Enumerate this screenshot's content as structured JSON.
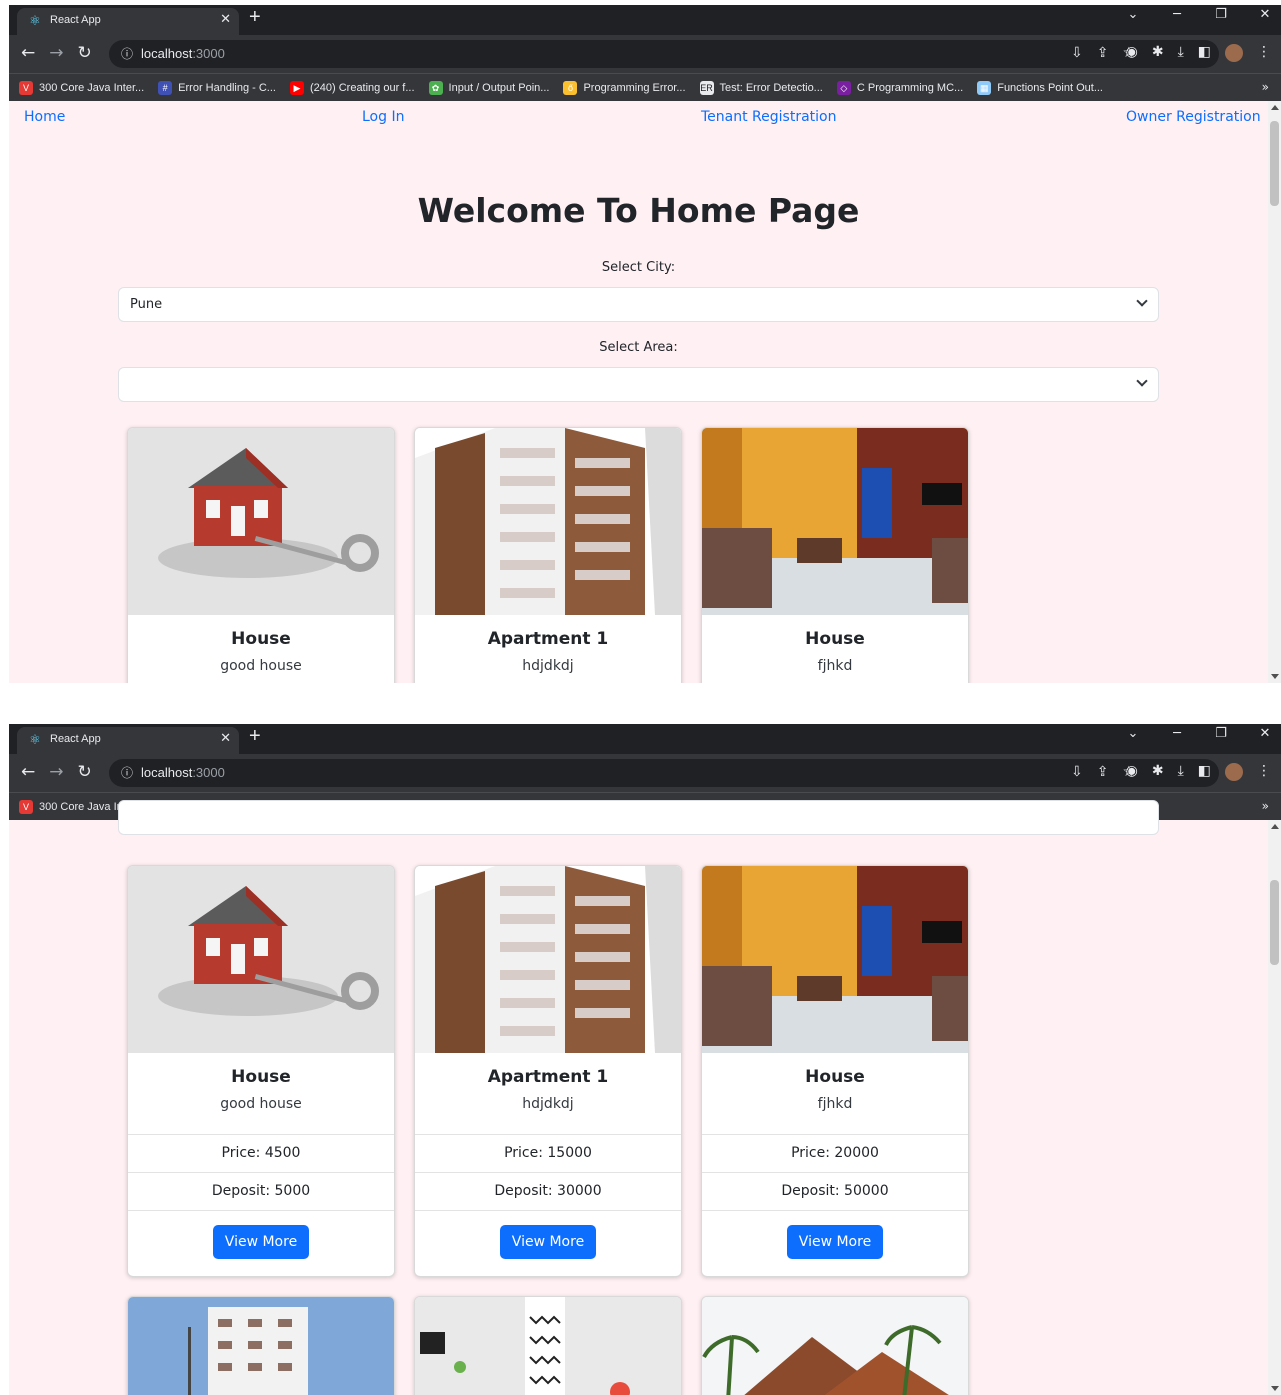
{
  "browser": {
    "tab_title": "React App",
    "url_host": "localhost",
    "url_port": ":3000",
    "bookmarks": [
      {
        "label": "300 Core Java Inter...",
        "color": "#e53935",
        "icon": "V"
      },
      {
        "label": "Error Handling - C...",
        "color": "#3f51b5",
        "icon": "#"
      },
      {
        "label": "(240) Creating our f...",
        "color": "#ff0000",
        "icon": "▶"
      },
      {
        "label": "Input / Output Poin...",
        "color": "#4caf50",
        "icon": "✿"
      },
      {
        "label": "Programming Error...",
        "color": "#fbc02d",
        "icon": "ő"
      },
      {
        "label": "Test: Error Detectio...",
        "color": "#e8eaed",
        "icon": "ER"
      },
      {
        "label": "C Programming MC...",
        "color": "#7b1fa2",
        "icon": "◇"
      },
      {
        "label": "Functions Point Out...",
        "color": "#90caf9",
        "icon": "▦"
      }
    ]
  },
  "nav": {
    "home": "Home",
    "login": "Log In",
    "tenant": "Tenant Registration",
    "owner": "Owner Registration"
  },
  "page": {
    "heading": "Welcome To Home Page",
    "city_label": "Select City:",
    "city_value": "Pune",
    "area_label": "Select Area:",
    "area_value": ""
  },
  "cards": [
    {
      "title": "House",
      "desc": "good house",
      "price": "Price: 4500",
      "deposit": "Deposit: 5000",
      "button": "View More"
    },
    {
      "title": "Apartment 1",
      "desc": "hdjdkdj",
      "price": "Price: 15000",
      "deposit": "Deposit: 30000",
      "button": "View More"
    },
    {
      "title": "House",
      "desc": "fjhkd",
      "price": "Price: 20000",
      "deposit": "Deposit: 50000",
      "button": "View More"
    }
  ]
}
